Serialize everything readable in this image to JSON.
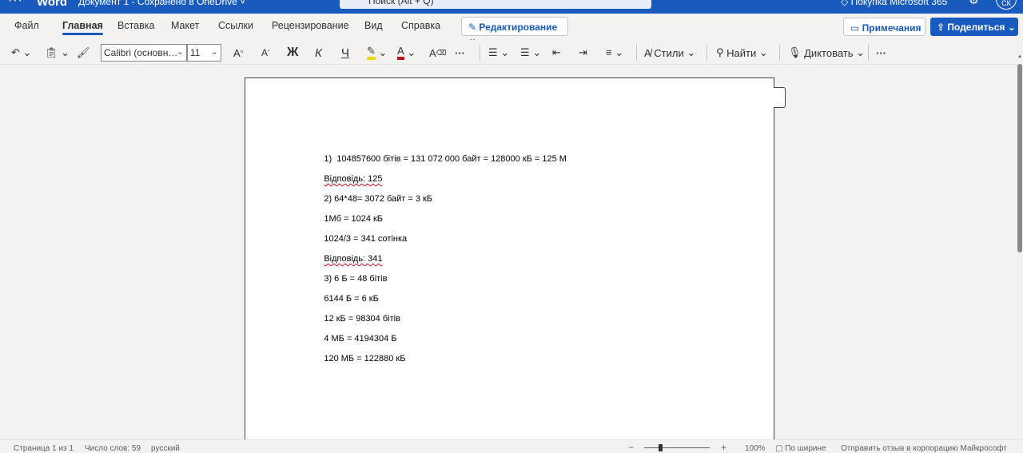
{
  "titlebar": {
    "waffle_icon": "waffle-icon",
    "app_name": "Word",
    "doc_status": "Документ 1 - Сохранено в OneDrive ˅",
    "search_placeholder": "Поиск (Alt + Q)",
    "buy_label": "Покупка Microsoft 365",
    "avatar_initials": "СК"
  },
  "menu": {
    "tabs": [
      "Файл",
      "Главная",
      "Вставка",
      "Макет",
      "Ссылки",
      "Рецензирование",
      "Вид",
      "Справка"
    ],
    "active_tab": "Главная",
    "edit_mode": "Редактирование",
    "notes": "Примечания",
    "share": "Поделиться"
  },
  "ribbon": {
    "font_name": "Calibri (основн…",
    "font_size": "11",
    "bold": "Ж",
    "italic": "К",
    "underline": "Ч",
    "styles": "Стили",
    "find": "Найти",
    "dictate": "Диктовать",
    "more": "···",
    "highlight_color": "#f5d800",
    "font_color": "#c50f1f"
  },
  "document": {
    "lines": [
      "1)  104857600 бітів = 131 072 000 байт = 128000 кБ = 125 М",
      "Відповідь: 125",
      "2) 64*48= 3072 байт = 3 кБ",
      "1Мб = 1024 кБ",
      "1024/3 = 341 сотінка",
      "Відповідь: 341",
      "3) 6 Б = 48 бітів",
      "6144 Б = 6 кБ",
      "12 кБ = 98304 бітів",
      "4 МБ = 4194304 Б",
      "120 МБ = 122880 кБ"
    ]
  },
  "status": {
    "page": "Страница 1 из 1",
    "words": "Число слов: 59",
    "language": "русский",
    "zoom_minus": "−",
    "zoom_plus": "+",
    "zoom_level": "100%",
    "fit": "По ширине",
    "feedback": "Отправить отзыв в корпорацию Майкрософт"
  }
}
